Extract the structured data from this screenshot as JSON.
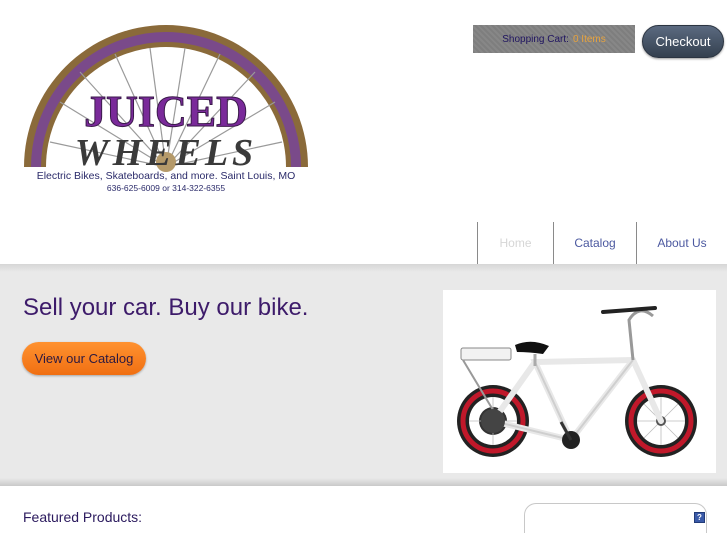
{
  "brand": {
    "word1": "JUICED",
    "word2": "WHEELS",
    "subtitle": "Electric Bikes, Skateboards, and more. Saint Louis, MO",
    "phones": "636-625-6009 or 314-322-6355"
  },
  "cart": {
    "label": "Shopping Cart:",
    "count": "0 Items"
  },
  "checkout_label": "Checkout",
  "nav": {
    "items": [
      {
        "label": "Home"
      },
      {
        "label": "Catalog"
      },
      {
        "label": "About Us"
      }
    ]
  },
  "hero": {
    "tagline": "Sell your car. Buy our bike.",
    "cta_label": "View our Catalog"
  },
  "featured": {
    "title": "Featured Products:",
    "help_glyph": "?"
  },
  "colors": {
    "accent_purple": "#3d1b6a",
    "cta_orange": "#f5801e",
    "cart_count": "#e8a33d",
    "nav_link": "#4c59a0"
  },
  "icons": [
    "help-icon"
  ]
}
